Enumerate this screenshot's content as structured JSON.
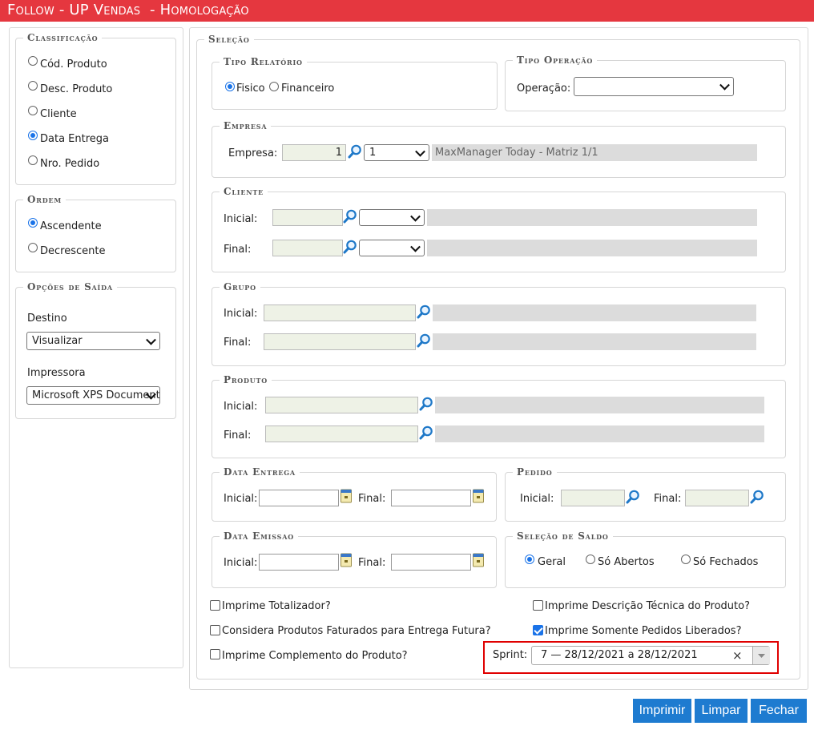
{
  "window": {
    "title": "Follow - UP Vendas  - Homologação"
  },
  "classificacao": {
    "legend": "Classificação",
    "options": [
      "Cód. Produto",
      "Desc. Produto",
      "Cliente",
      "Data Entrega",
      "Nro. Pedido"
    ],
    "selected": "Data Entrega"
  },
  "ordem": {
    "legend": "Ordem",
    "options": [
      "Ascendente",
      "Decrescente"
    ],
    "selected": "Ascendente"
  },
  "opcoes_saida": {
    "legend": "Opções de Saída",
    "destino_label": "Destino",
    "destino_value": "Visualizar",
    "impressora_label": "Impressora",
    "impressora_value": "Microsoft XPS Document Writer"
  },
  "selecao": {
    "legend": "Seleção",
    "tipo_relatorio": {
      "legend": "Tipo Relatório",
      "options": [
        "Fisico",
        "Financeiro"
      ],
      "selected": "Fisico"
    },
    "tipo_operacao": {
      "legend": "Tipo Operação",
      "label": "Operação:",
      "value": ""
    },
    "empresa": {
      "legend": "Empresa",
      "label": "Empresa:",
      "code": "1",
      "select_value": "1",
      "description": "MaxManager Today - Matriz 1/1"
    },
    "cliente": {
      "legend": "Cliente",
      "inicial_label": "Inicial:",
      "final_label": "Final:"
    },
    "grupo": {
      "legend": "Grupo",
      "inicial_label": "Inicial:",
      "final_label": "Final:"
    },
    "produto": {
      "legend": "Produto",
      "inicial_label": "Inicial:",
      "final_label": "Final:"
    },
    "data_entrega": {
      "legend": "Data Entrega",
      "inicial_label": "Inicial:",
      "final_label": "Final:"
    },
    "pedido": {
      "legend": "Pedido",
      "inicial_label": "Inicial:",
      "final_label": "Final:"
    },
    "data_emissao": {
      "legend": "Data Emissao",
      "inicial_label": "Inicial:",
      "final_label": "Final:"
    },
    "selecao_saldo": {
      "legend": "Seleção de Saldo",
      "options": [
        "Geral",
        "Só Abertos",
        "Só Fechados"
      ],
      "selected": "Geral"
    },
    "checks": {
      "totalizador": "Imprime Totalizador?",
      "descricao_tecnica": "Imprime Descrição Técnica do Produto?",
      "faturados": "Considera Produtos Faturados para Entrega Futura?",
      "pedidos_liberados": "Imprime Somente Pedidos Liberados?",
      "complemento": "Imprime Complemento do Produto?"
    },
    "checked": [
      "pedidos_liberados"
    ],
    "sprint": {
      "label": "Sprint:",
      "value": "7 — 28/12/2021 a 28/12/2021",
      "clear": "×"
    }
  },
  "buttons": {
    "imprimir": "Imprimir",
    "limpar": "Limpar",
    "fechar": "Fechar"
  },
  "colors": {
    "title_bar": "#e5373f",
    "button": "#1e7bd0",
    "highlight": "#e00000",
    "accent": "#1a73e8"
  }
}
